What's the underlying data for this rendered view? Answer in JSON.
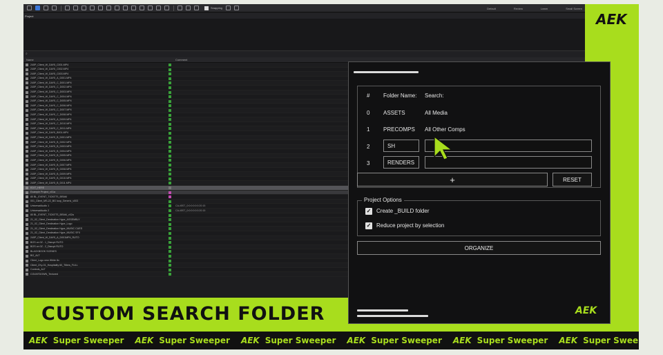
{
  "app": {
    "toolbar": {
      "snapping_label": "Snapping",
      "workspaces": [
        "Default",
        "Review",
        "Learn",
        "Small Screen"
      ]
    },
    "project_header": "Project",
    "search_symbol": "⌕",
    "columns": {
      "name": "Name",
      "comment": "Comment"
    },
    "rows": [
      {
        "name": "240P_Client_W_DAY5_C001.MP4",
        "label": "#3aa23a",
        "comment": ""
      },
      {
        "name": "240P_Client_W_DAY5_C002.MP4",
        "label": "#3aa23a",
        "comment": ""
      },
      {
        "name": "240P_Client_W_DAY5_C003.MP4",
        "label": "#3aa23a",
        "comment": ""
      },
      {
        "name": "240P_Client_W_DAY5_A_D001.MP4",
        "label": "#3aa23a",
        "comment": ""
      },
      {
        "name": "240P_Client_W_DAY5_C_D001.MP4",
        "label": "#3aa23a",
        "comment": ""
      },
      {
        "name": "240P_Client_W_DAY5_C_D002.MP4",
        "label": "#3aa23a",
        "comment": ""
      },
      {
        "name": "240P_Client_W_DAY5_C_D003.MP4",
        "label": "#3aa23a",
        "comment": ""
      },
      {
        "name": "240P_Client_W_DAY5_C_D004.MP4",
        "label": "#3aa23a",
        "comment": ""
      },
      {
        "name": "240P_Client_W_DAY5_C_D005.MP4",
        "label": "#3aa23a",
        "comment": ""
      },
      {
        "name": "240P_Client_W_DAY5_C_D006.MP4",
        "label": "#3aa23a",
        "comment": ""
      },
      {
        "name": "240P_Client_W_DAY5_C_D007.MP4",
        "label": "#3aa23a",
        "comment": ""
      },
      {
        "name": "240P_Client_W_DAY5_C_D008.MP4",
        "label": "#3aa23a",
        "comment": ""
      },
      {
        "name": "240P_Client_W_DAY5_A_D009.MP4",
        "label": "#3aa23a",
        "comment": ""
      },
      {
        "name": "240P_Client_W_DAY5_C_D010.MP4",
        "label": "#3aa23a",
        "comment": ""
      },
      {
        "name": "240P_Client_W_DAY5_C_D011.MP4",
        "label": "#3aa23a",
        "comment": ""
      },
      {
        "name": "240P_Client_W_DAY5_B001.MP4",
        "label": "#3aa23a",
        "comment": ""
      },
      {
        "name": "240P_Client_W_DAY5_B_D001.MP4",
        "label": "#3aa23a",
        "comment": ""
      },
      {
        "name": "240P_Client_W_DAY5_B_D002.MP4",
        "label": "#3aa23a",
        "comment": ""
      },
      {
        "name": "240P_Client_W_DAY5_B_D003.MP4",
        "label": "#3aa23a",
        "comment": ""
      },
      {
        "name": "240P_Client_W_DAY5_B_D004.MP4",
        "label": "#3aa23a",
        "comment": ""
      },
      {
        "name": "240P_Client_W_DAY5_B_D005.MP4",
        "label": "#3aa23a",
        "comment": ""
      },
      {
        "name": "240P_Client_W_DAY5_B_D006.MP4",
        "label": "#3aa23a",
        "comment": ""
      },
      {
        "name": "240P_Client_W_DAY5_B_D007.MP4",
        "label": "#3aa23a",
        "comment": ""
      },
      {
        "name": "240P_Client_W_DAY5_B_D008.MP4",
        "label": "#3aa23a",
        "comment": ""
      },
      {
        "name": "240P_Client_W_DAY5_B_D009.MP4",
        "label": "#3aa23a",
        "comment": ""
      },
      {
        "name": "240P_Client_W_DAY5_B_D010.MP4",
        "label": "#3aa23a",
        "comment": ""
      },
      {
        "name": "240P_Client_W_DAY5_B_D011.MP4",
        "label": "#3aa23a",
        "comment": ""
      },
      {
        "name": "EDIT_HERE",
        "label": "#777777",
        "comment": "",
        "style": "hl"
      },
      {
        "name": "Example Project_v01a",
        "label": "#c04ab0",
        "comment": "",
        "style": "hl2"
      },
      {
        "name": "80 BL_EVENT_TICKETS_BRAM",
        "label": "#c04ab0",
        "comment": ""
      },
      {
        "name": "001_Client_MS-22_BG loop_Generic_v003",
        "label": "#3aa23a",
        "comment": ""
      },
      {
        "name": "UniversalAudio 1",
        "label": "#3aa23a",
        "comment": "CA-ii5ST_0:0:0:0:0:0:20:15"
      },
      {
        "name": "UniversalAudio 2",
        "label": "#3aa23a",
        "comment": "CA-ii5ST_0:0:0:0:0:0:20:15"
      },
      {
        "name": "80 BL_EVENT_TICKETS_BRAM_v02a",
        "label": "#3aa23a",
        "comment": ""
      },
      {
        "name": "21_02_Client_Destination Hype_ASSEMBLY",
        "label": "#3aa23a",
        "comment": ""
      },
      {
        "name": "21_02_Client_Destination Hype_Logo",
        "label": "#3aa23a",
        "comment": ""
      },
      {
        "name": "21_02_Client_Destination Hype_MUSIC CUES",
        "label": "#3aa23a",
        "comment": ""
      },
      {
        "name": "21_02_Client_Destination Hype_MUSIC SFX",
        "label": "#3aa23a",
        "comment": ""
      },
      {
        "name": "240P_Client_W_DAY5_A_D001MP4_RUTO",
        "label": "#3aa23a",
        "comment": ""
      },
      {
        "name": "BOS on 0Z - 1_Disrupt RUTO",
        "label": "#3aa23a",
        "comment": ""
      },
      {
        "name": "BOS on 0Z - 2_Disrupt RUTO",
        "label": "#3aa23a",
        "comment": ""
      },
      {
        "name": "BLACKBOOK SCENES",
        "label": "#3aa23a",
        "comment": ""
      },
      {
        "name": "BG_ALT",
        "label": "#3aa23a",
        "comment": ""
      },
      {
        "name": "Client_Logo new White 8x",
        "label": "#3aa23a",
        "comment": ""
      },
      {
        "name": "Client_2Xy-01_Hospitality 60_Titlers_FULL",
        "label": "#3aa23a",
        "comment": ""
      },
      {
        "name": "Controls_ALT",
        "label": "#3aa23a",
        "comment": ""
      },
      {
        "name": "COUNTDOWN_Textured",
        "label": "#3aa23a",
        "comment": ""
      }
    ]
  },
  "panel": {
    "headers": {
      "num": "#",
      "folder_name": "Folder Name:",
      "search": "Search:"
    },
    "rows": [
      {
        "num": "0",
        "folder": "ASSETS",
        "search": "All Media"
      },
      {
        "num": "1",
        "folder": "PRECOMPS",
        "search": "All Other Comps"
      },
      {
        "num": "2",
        "folder": "SH",
        "search": ""
      },
      {
        "num": "3",
        "folder": "RENDERS",
        "search": ""
      }
    ],
    "add_button": "+",
    "reset_button": "RESET",
    "options_title": "Project Options",
    "option_1": {
      "label": "Create _BUILD folder",
      "checked": true
    },
    "option_2": {
      "label": "Reduce project by selection",
      "checked": true
    },
    "organize_button": "ORGANIZE",
    "logo": "AEK"
  },
  "overlay": {
    "title": "CUSTOM SEARCH FOLDER",
    "brand_logo": "AEK",
    "ticker_logo": "AEK",
    "ticker_text": "Super Sweeper",
    "ticker_repeats": 6
  },
  "colors": {
    "accent": "#a8dd1d",
    "panel_bg": "#111112"
  }
}
